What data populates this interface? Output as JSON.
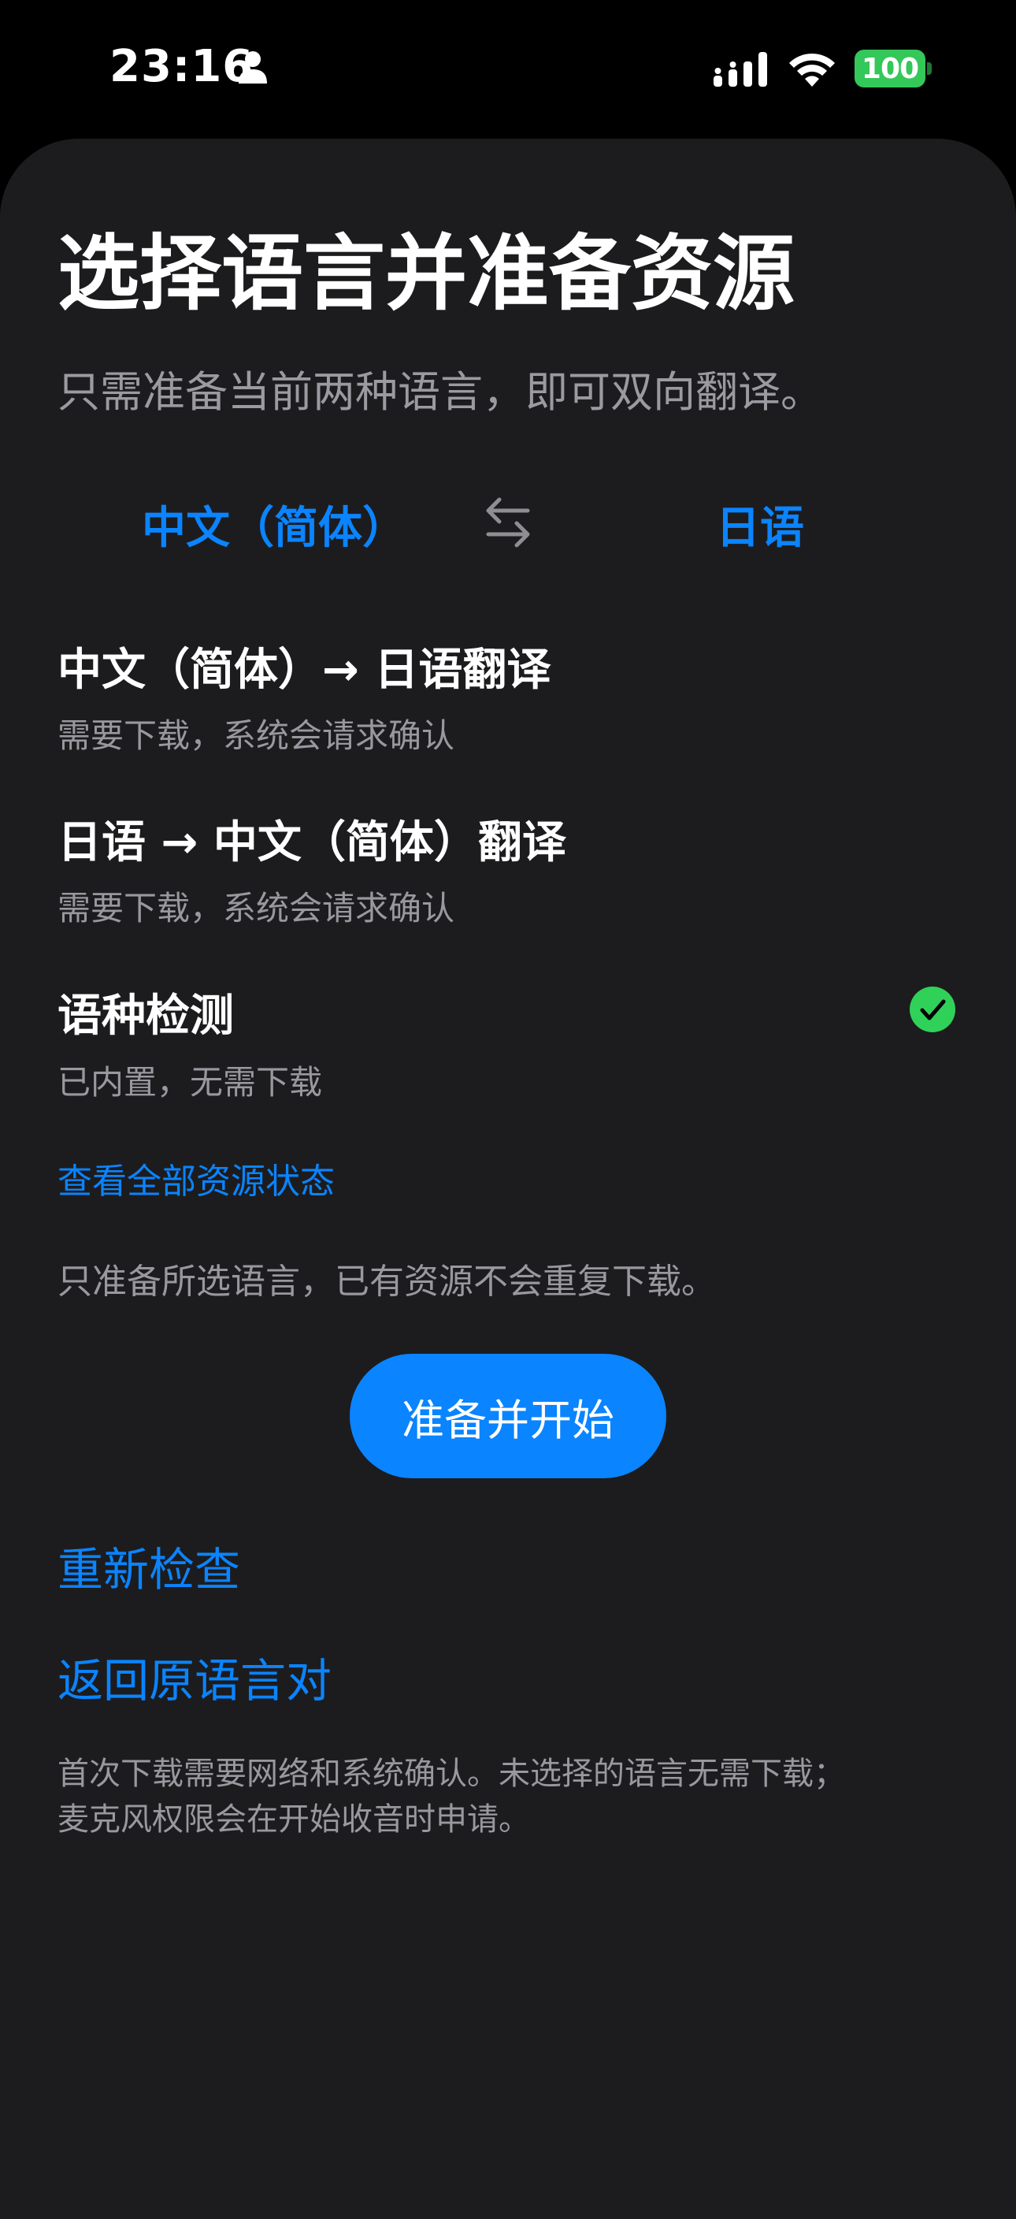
{
  "status_bar": {
    "time": "23:16",
    "battery": "100",
    "icons": [
      "person-icon",
      "signal-icon",
      "wifi-icon",
      "battery-icon"
    ],
    "battery_color": "#34c759"
  },
  "page": {
    "title": "选择语言并准备资源",
    "subtitle": "只需准备当前两种语言，即可双向翻译。"
  },
  "language_pair": {
    "source": "中文（简体）",
    "target": "日语",
    "swap_icon": "swap-arrows-icon"
  },
  "resources": [
    {
      "title": "中文（简体）→ 日语翻译",
      "note": "需要下载，系统会请求确认",
      "ready": false
    },
    {
      "title": "日语 → 中文（简体）翻译",
      "note": "需要下载，系统会请求确认",
      "ready": false
    },
    {
      "title": "语种检测",
      "note": "已内置，无需下载",
      "ready": true
    }
  ],
  "view_all_link": "查看全部资源状态",
  "info": "只准备所选语言，已有资源不会重复下载。",
  "primary_button": "准备并开始",
  "recheck_link": "重新检查",
  "back_link": "返回原语言对",
  "footnote": {
    "line1": "首次下载需要网络和系统确认。未选择的语言无需下载；",
    "line2": "麦克风权限会在开始收音时申请。"
  },
  "colors": {
    "accent": "#0a84ff",
    "background": "#1c1c1e",
    "success": "#30d158",
    "secondary_text": "#98989e"
  }
}
